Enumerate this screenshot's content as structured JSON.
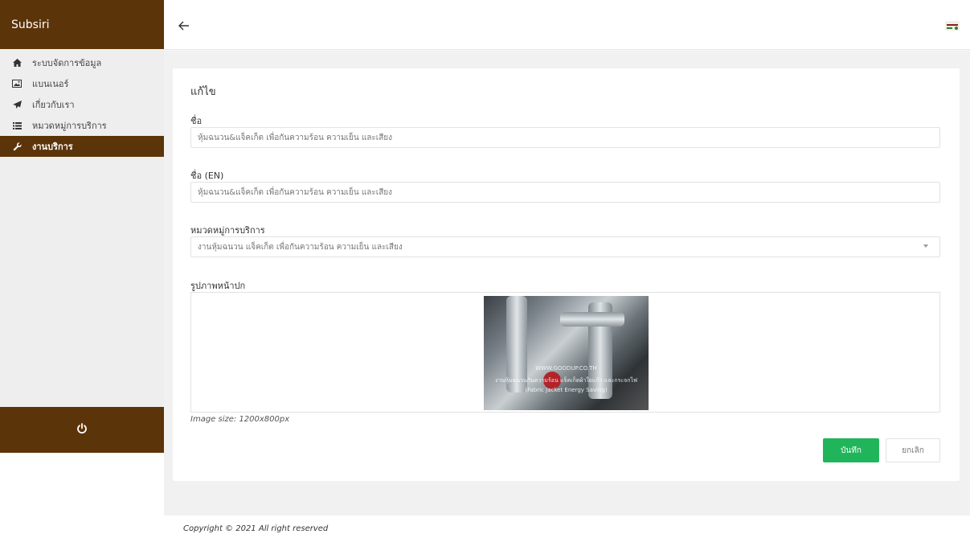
{
  "brand": "Subsiri",
  "sidebar": {
    "items": [
      {
        "label": "ระบบจัดการข้อมูล",
        "icon": "home-icon",
        "active": false
      },
      {
        "label": "แบนเนอร์",
        "icon": "image-icon",
        "active": false
      },
      {
        "label": "เกี่ยวกับเรา",
        "icon": "paper-plane-icon",
        "active": false
      },
      {
        "label": "หมวดหมู่การบริการ",
        "icon": "list-icon",
        "active": false
      },
      {
        "label": "งานบริการ",
        "icon": "wrench-icon",
        "active": true
      }
    ],
    "logout_icon": "power-icon"
  },
  "form": {
    "title": "แก้ไข",
    "name_label": "ชื่อ",
    "name_value": "หุ้มฉนวน&แจ็คเก็ต เพื่อกันความร้อน ความเย็น และเสียง",
    "name_en_label": "ชื่อ (EN)",
    "name_en_value": "หุ้มฉนวน&แจ็คเก็ต เพื่อกันความร้อน ความเย็น และเสียง",
    "category_label": "หมวดหมู่การบริการ",
    "category_value": "งานหุ้มฉนวน แจ็คเก็ต เพื่อกันความร้อน ความเย็น และเสียง",
    "cover_label": "รูปภาพหน้าปก",
    "cover_watermark_line1": "WWW.GOODUP.CO.TH",
    "cover_watermark_line2": "งานหุ้มฉนวนกันความร้อน แจ็คเก็ตผ้าใยแก้ว และกระจกไฟ",
    "cover_watermark_line3": "(Fabric Jacket Energy Saving)",
    "image_hint": "Image size: 1200x800px",
    "save_label": "บันทึก",
    "cancel_label": "ยกเลิก"
  },
  "footer": "Copyright © 2021 All right reserved",
  "colors": {
    "brand_brown": "#5c3409",
    "save_green": "#21b55b"
  }
}
